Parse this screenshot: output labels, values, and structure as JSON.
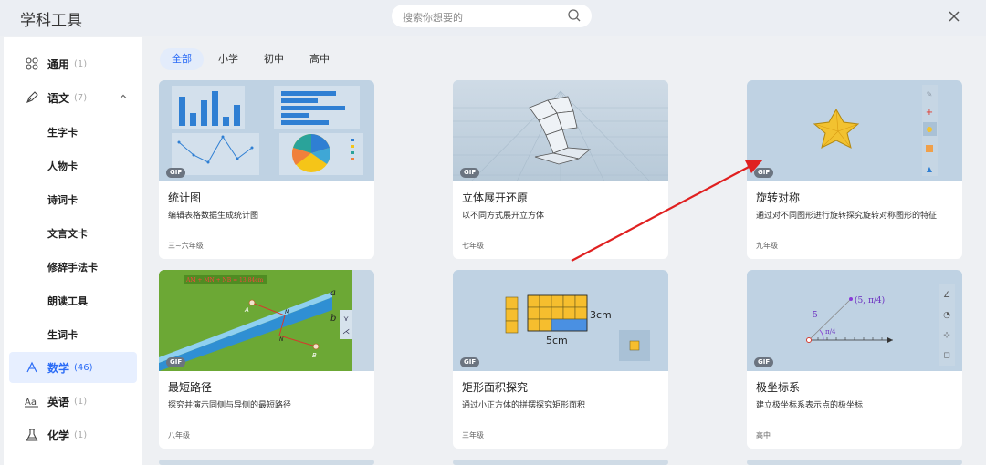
{
  "app": {
    "title": "学科工具"
  },
  "search": {
    "placeholder": "搜索你想要的"
  },
  "sidebar": {
    "items": [
      {
        "label": "通用",
        "count": "(1)",
        "icon": "grid-icon"
      },
      {
        "label": "语文",
        "count": "(7)",
        "icon": "pen-icon"
      },
      {
        "label": "数学",
        "count": "(46)",
        "icon": "math-icon"
      },
      {
        "label": "英语",
        "count": "(1)",
        "icon": "aa-icon"
      },
      {
        "label": "化学",
        "count": "(1)",
        "icon": "flask-icon"
      }
    ],
    "subitems": [
      "生字卡",
      "人物卡",
      "诗词卡",
      "文言文卡",
      "修辞手法卡",
      "朗读工具",
      "生词卡"
    ]
  },
  "tabs": [
    "全部",
    "小学",
    "初中",
    "高中"
  ],
  "cards": [
    {
      "title": "统计图",
      "desc": "编辑表格数据生成统计图",
      "grade": "三~六年级",
      "badge": "GIF"
    },
    {
      "title": "立体展开还原",
      "desc": "以不同方式展开立方体",
      "grade": "七年级",
      "badge": "GIF"
    },
    {
      "title": "旋转对称",
      "desc": "通过对不同图形进行旋转探究旋转对称图形的特征",
      "grade": "九年级",
      "badge": "GIF"
    },
    {
      "title": "最短路径",
      "desc": "探究并演示同侧与异侧的最短路径",
      "grade": "八年级",
      "badge": "GIF"
    },
    {
      "title": "矩形面积探究",
      "desc": "通过小正方体的拼摆探究矩形面积",
      "grade": "三年级",
      "badge": "GIF"
    },
    {
      "title": "极坐标系",
      "desc": "建立极坐标系表示点的极坐标",
      "grade": "高中",
      "badge": "GIF"
    }
  ],
  "thumb_text": {
    "rect_3": "3cm",
    "rect_5": "5cm",
    "polar_point": "(5, π/4)",
    "polar_r": "5",
    "polar_angle": "π/4",
    "path_a": "a",
    "path_b": "b",
    "path_formula": "AM + MN + NB = 13.84cm",
    "path_A": "A",
    "path_B": "B",
    "path_M": "M",
    "path_N": "N"
  },
  "colors": {
    "accent": "#2b6cf6",
    "arrow": "#e02020",
    "thumb_bg": "#bfd2e3"
  }
}
